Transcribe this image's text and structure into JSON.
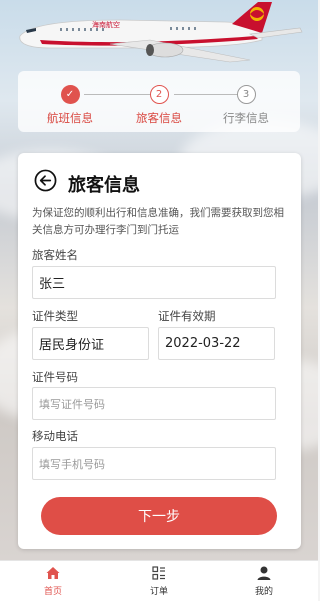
{
  "colors": {
    "accent": "#df4e47",
    "muted": "#888888"
  },
  "steps": [
    {
      "num": "✓",
      "label": "航班信息",
      "state": "done"
    },
    {
      "num": "2",
      "label": "旅客信息",
      "state": "current"
    },
    {
      "num": "3",
      "label": "行李信息",
      "state": "todo"
    }
  ],
  "form": {
    "title": "旅客信息",
    "description": "为保证您的顺利出行和信息准确，我们需要获取到您相关信息方可办理行李门到门托运",
    "name_label": "旅客姓名",
    "name_value": "张三",
    "id_type_label": "证件类型",
    "id_type_value": "居民身份证",
    "id_expiry_label": "证件有效期",
    "id_expiry_value": "2022-03-22",
    "id_number_label": "证件号码",
    "id_number_placeholder": "填写证件号码",
    "phone_label": "移动电话",
    "phone_placeholder": "填写手机号码",
    "next_label": "下一步"
  },
  "nav": {
    "home": {
      "label": "首页",
      "icon": "home-icon"
    },
    "orders": {
      "label": "订单",
      "icon": "orders-icon"
    },
    "mine": {
      "label": "我的",
      "icon": "user-icon"
    }
  },
  "banner": {
    "airline_text": "海南航空"
  }
}
